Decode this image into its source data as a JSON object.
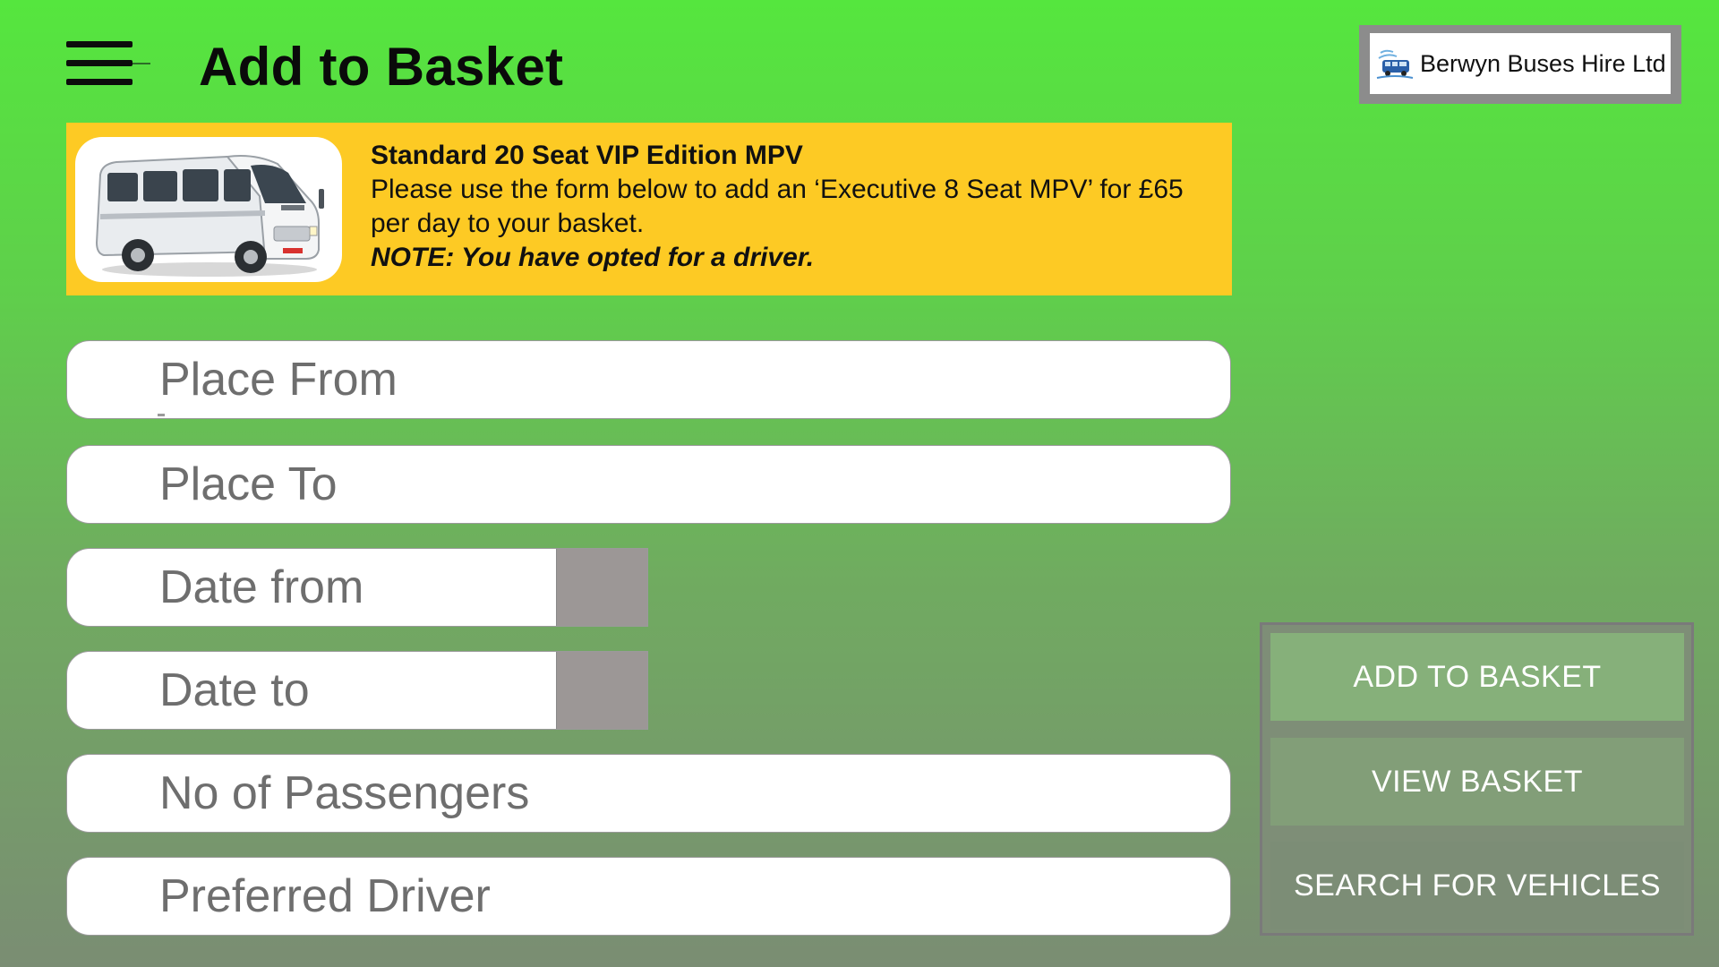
{
  "header": {
    "title": "Add to Basket",
    "company": "Berwyn Buses Hire Ltd"
  },
  "banner": {
    "title": "Standard 20 Seat VIP Edition MPV",
    "description": "Please use the form below to add an ‘Executive 8 Seat MPV’ for £65 per day to your basket.",
    "note": "NOTE: You have opted for a driver.",
    "image_icon": "minibus-image",
    "background_color": "#fdca24"
  },
  "form": {
    "place_from": "Place From",
    "place_to": "Place To",
    "date_from": "Date from",
    "date_to": "Date to",
    "passengers": "No of Passengers",
    "driver": "Preferred Driver"
  },
  "actions": {
    "add_to_basket": "ADD TO BASKET",
    "view_basket": "VIEW BASKET",
    "search_vehicles": "SEARCH FOR VEHICLES"
  },
  "colors": {
    "background_top": "#55e63e",
    "background_bottom": "#7a8d73",
    "banner": "#fdca24",
    "date_button": "#9c9796"
  }
}
